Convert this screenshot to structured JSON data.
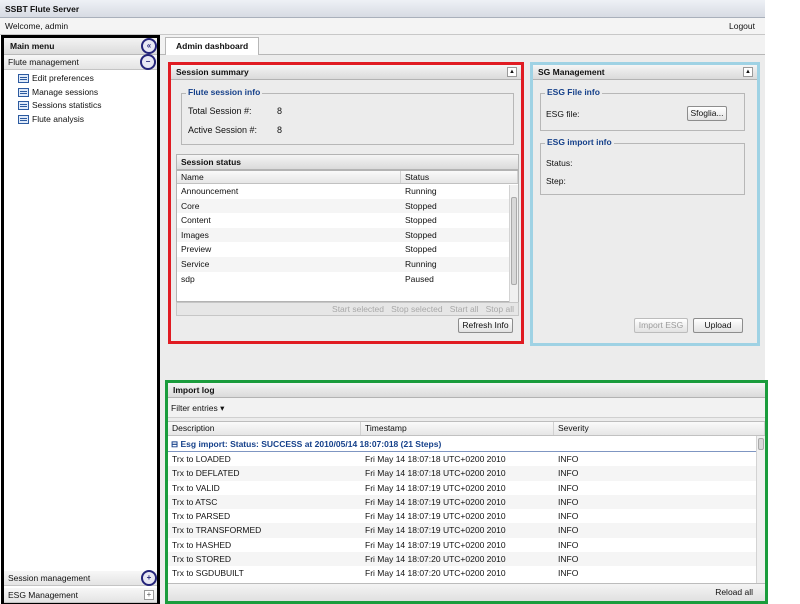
{
  "app": {
    "title": "SSBT Flute Server",
    "welcome": "Welcome, admin",
    "logout": "Logout"
  },
  "sidebar": {
    "title": "Main menu",
    "collapse_glyph": "«",
    "section_flute": "Flute management",
    "section_toggle": "−",
    "items": [
      {
        "label": "Edit preferences",
        "icon": "page-icon"
      },
      {
        "label": "Manage sessions",
        "icon": "page-icon"
      },
      {
        "label": "Sessions statistics",
        "icon": "page-icon"
      },
      {
        "label": "Flute analysis",
        "icon": "page-icon"
      }
    ],
    "section_session": "Session management",
    "section_esg": "ESG Management",
    "expand_glyph": "+"
  },
  "tabs": {
    "active": "Admin dashboard"
  },
  "session_summary": {
    "title": "Session summary",
    "info_legend": "Flute session info",
    "total_label": "Total Session #:",
    "total_value": "8",
    "active_label": "Active Session #:",
    "active_value": "8",
    "status_title": "Session status",
    "columns": [
      "Name",
      "Status"
    ],
    "rows": [
      {
        "name": "Announcement",
        "status": "Running"
      },
      {
        "name": "Core",
        "status": "Stopped"
      },
      {
        "name": "Content",
        "status": "Stopped"
      },
      {
        "name": "Images",
        "status": "Stopped"
      },
      {
        "name": "Preview",
        "status": "Stopped"
      },
      {
        "name": "Service",
        "status": "Running"
      },
      {
        "name": "sdp",
        "status": "Paused"
      }
    ],
    "actions": {
      "start_selected": "Start selected",
      "stop_selected": "Stop selected",
      "start_all": "Start all",
      "stop_all": "Stop all"
    },
    "refresh": "Refresh Info"
  },
  "esg": {
    "title": "SG Management",
    "file_legend": "ESG File info",
    "file_label": "ESG file:",
    "browse": "Sfoglia...",
    "import_legend": "ESG import info",
    "status_label": "Status:",
    "step_label": "Step:",
    "import_button": "Import ESG",
    "upload_button": "Upload"
  },
  "import_log": {
    "title": "Import log",
    "filter": "Filter entries",
    "columns": [
      "Description",
      "Timestamp",
      "Severity"
    ],
    "group_label": "Esg import: Status: SUCCESS at 2010/05/14 18:07:018 (21 Steps)",
    "rows": [
      {
        "desc": "Trx to LOADED",
        "time": "Fri May 14 18:07:18 UTC+0200 2010",
        "sev": "INFO"
      },
      {
        "desc": "Trx to DEFLATED",
        "time": "Fri May 14 18:07:18 UTC+0200 2010",
        "sev": "INFO"
      },
      {
        "desc": "Trx to VALID",
        "time": "Fri May 14 18:07:19 UTC+0200 2010",
        "sev": "INFO"
      },
      {
        "desc": "Trx to ATSC",
        "time": "Fri May 14 18:07:19 UTC+0200 2010",
        "sev": "INFO"
      },
      {
        "desc": "Trx to PARSED",
        "time": "Fri May 14 18:07:19 UTC+0200 2010",
        "sev": "INFO"
      },
      {
        "desc": "Trx to TRANSFORMED",
        "time": "Fri May 14 18:07:19 UTC+0200 2010",
        "sev": "INFO"
      },
      {
        "desc": "Trx to HASHED",
        "time": "Fri May 14 18:07:19 UTC+0200 2010",
        "sev": "INFO"
      },
      {
        "desc": "Trx to STORED",
        "time": "Fri May 14 18:07:20 UTC+0200 2010",
        "sev": "INFO"
      },
      {
        "desc": "Trx to SGDUBUILT",
        "time": "Fri May 14 18:07:20 UTC+0200 2010",
        "sev": "INFO"
      }
    ],
    "reload": "Reload all"
  },
  "colors": {
    "session_border": "#e01b22",
    "esg_border": "#9fd2e4",
    "log_border": "#1a9c3c",
    "sidebar_border": "#000000",
    "accent": "#15408a"
  }
}
